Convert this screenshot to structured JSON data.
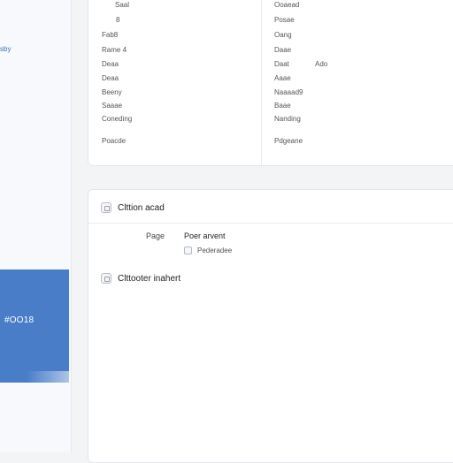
{
  "sidebar": {
    "link_text": "sby",
    "selected_label": "#OO18"
  },
  "details": {
    "left_fields": [
      {
        "label": "Saal"
      },
      {
        "label": "8"
      },
      {
        "label": "Fab8"
      },
      {
        "label": "Rame  4"
      },
      {
        "label": "Deaa"
      },
      {
        "label": "Deaa"
      },
      {
        "label": "Beeny"
      },
      {
        "label": "Saaae"
      },
      {
        "label": "Coneding"
      },
      {
        "label": "Poacde"
      }
    ],
    "right_fields": [
      {
        "label": "Ooaead"
      },
      {
        "label": "Posae"
      },
      {
        "label": "Oang"
      },
      {
        "label": "Daae"
      },
      {
        "label": "Daat",
        "value": "Ado"
      },
      {
        "label": "Aaae"
      },
      {
        "label": "Naaaad9"
      },
      {
        "label": "Baae"
      },
      {
        "label": "Nanding"
      },
      {
        "label": "Pdgeane"
      }
    ]
  },
  "section1": {
    "title": "Clttion acad",
    "row_label": "Page",
    "row_value": "Poer arvent",
    "sub_label": "Pederadee"
  },
  "section2": {
    "title": "Clttooter inahert"
  }
}
